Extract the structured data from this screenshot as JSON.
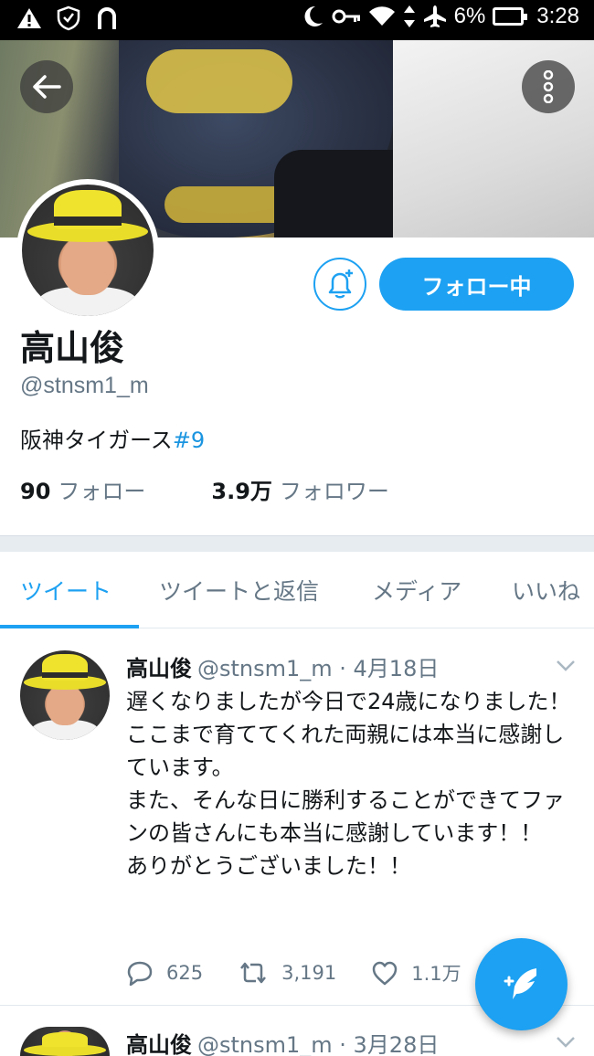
{
  "statusbar": {
    "battery": "6%",
    "time": "3:28"
  },
  "profile": {
    "follow_button_label": "フォロー中",
    "name": "高山俊",
    "handle": "@stnsm1_m",
    "bio_text": "阪神タイガース",
    "bio_tag": "#9",
    "following_count": "90",
    "following_label": "フォロー",
    "followers_count": "3.9万",
    "followers_label": "フォロワー"
  },
  "tabs": [
    {
      "label": "ツイート",
      "active": true
    },
    {
      "label": "ツイートと返信",
      "active": false
    },
    {
      "label": "メディア",
      "active": false
    },
    {
      "label": "いいね",
      "active": false
    }
  ],
  "tweets": [
    {
      "name": "高山俊",
      "meta": "@stnsm1_m · 4月18日",
      "text": "遅くなりましたが今日で24歳になりました！\nここまで育ててくれた両親には本当に感謝しています。\nまた、そんな日に勝利することができてファンの皆さんにも本当に感謝しています！！\nありがとうございました！！",
      "replies": "625",
      "retweets": "3,191",
      "likes": "1.1万"
    },
    {
      "name": "高山俊",
      "meta": "@stnsm1_m · 3月28日"
    }
  ],
  "colors": {
    "accent": "#1da1f2",
    "muted": "#657786"
  }
}
